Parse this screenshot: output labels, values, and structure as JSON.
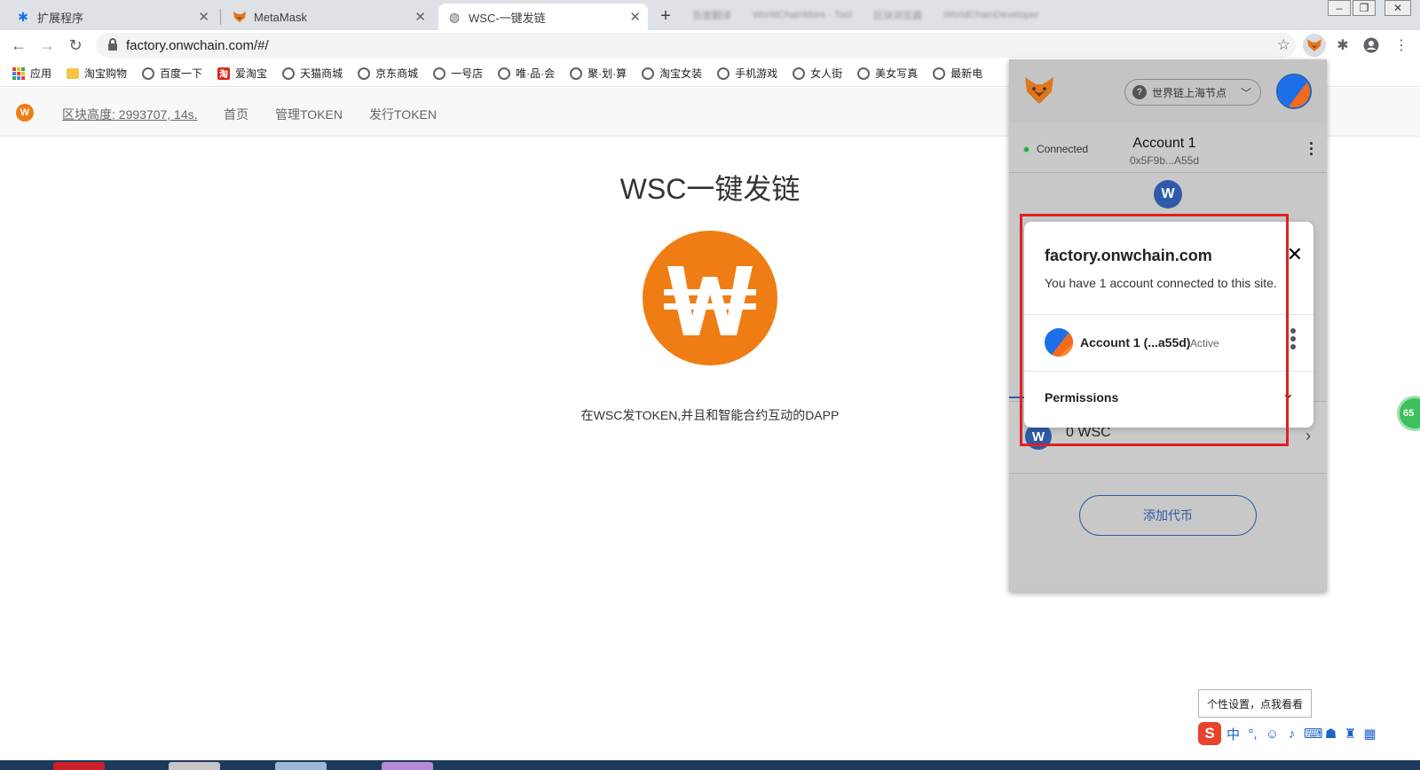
{
  "browser": {
    "tabs": [
      {
        "title": "扩展程序",
        "icon": "puzzle-icon"
      },
      {
        "title": "MetaMask",
        "icon": "metamask-fox-icon"
      },
      {
        "title": "WSC-一键发链",
        "icon": "globe-icon",
        "active": true
      }
    ],
    "background_tabs_blurred": [
      "百度翻译",
      "WorldChainMore - Tool",
      "区块浏览器",
      "WorldChainDeveloper"
    ],
    "url": "factory.onwchain.com/#/"
  },
  "bookmarks": [
    {
      "label": "应用",
      "icon": "apps-grid-icon"
    },
    {
      "label": "淘宝购物",
      "icon": "folder-icon"
    },
    {
      "label": "百度一下",
      "icon": "globe-icon"
    },
    {
      "label": "爱淘宝",
      "icon": "taobao-icon"
    },
    {
      "label": "天猫商城",
      "icon": "globe-icon"
    },
    {
      "label": "京东商城",
      "icon": "globe-icon"
    },
    {
      "label": "一号店",
      "icon": "globe-icon"
    },
    {
      "label": "唯·品·会",
      "icon": "globe-icon"
    },
    {
      "label": "聚·划·算",
      "icon": "globe-icon"
    },
    {
      "label": "淘宝女装",
      "icon": "globe-icon"
    },
    {
      "label": "手机游戏",
      "icon": "globe-icon"
    },
    {
      "label": "女人街",
      "icon": "globe-icon"
    },
    {
      "label": "美女写真",
      "icon": "globe-icon"
    },
    {
      "label": "最新电",
      "icon": "globe-icon"
    }
  ],
  "site": {
    "nav": {
      "block_height": "区块高度: 2993707, 14s.",
      "home": "首页",
      "manage": "管理TOKEN",
      "issue": "发行TOKEN"
    },
    "title": "WSC一键发链",
    "subtitle": "在WSC发TOKEN,并且和智能合约互动的DAPP",
    "accent": "#f07d14"
  },
  "metamask": {
    "network": "世界链上海节点",
    "status": "Connected",
    "account_name": "Account 1",
    "account_address": "0x5F9b...A55d",
    "asset": "0 WSC",
    "add_token": "添加代币",
    "modal": {
      "site": "factory.onwchain.com",
      "description": "You have 1 account connected to this site.",
      "account": "Account 1 (...a55d)",
      "account_status": "Active",
      "permissions": "Permissions"
    },
    "accent": "#2e5aa8"
  },
  "float_badge": "65",
  "ime": {
    "tooltip": "个性设置，点我看看",
    "mode": "中"
  }
}
